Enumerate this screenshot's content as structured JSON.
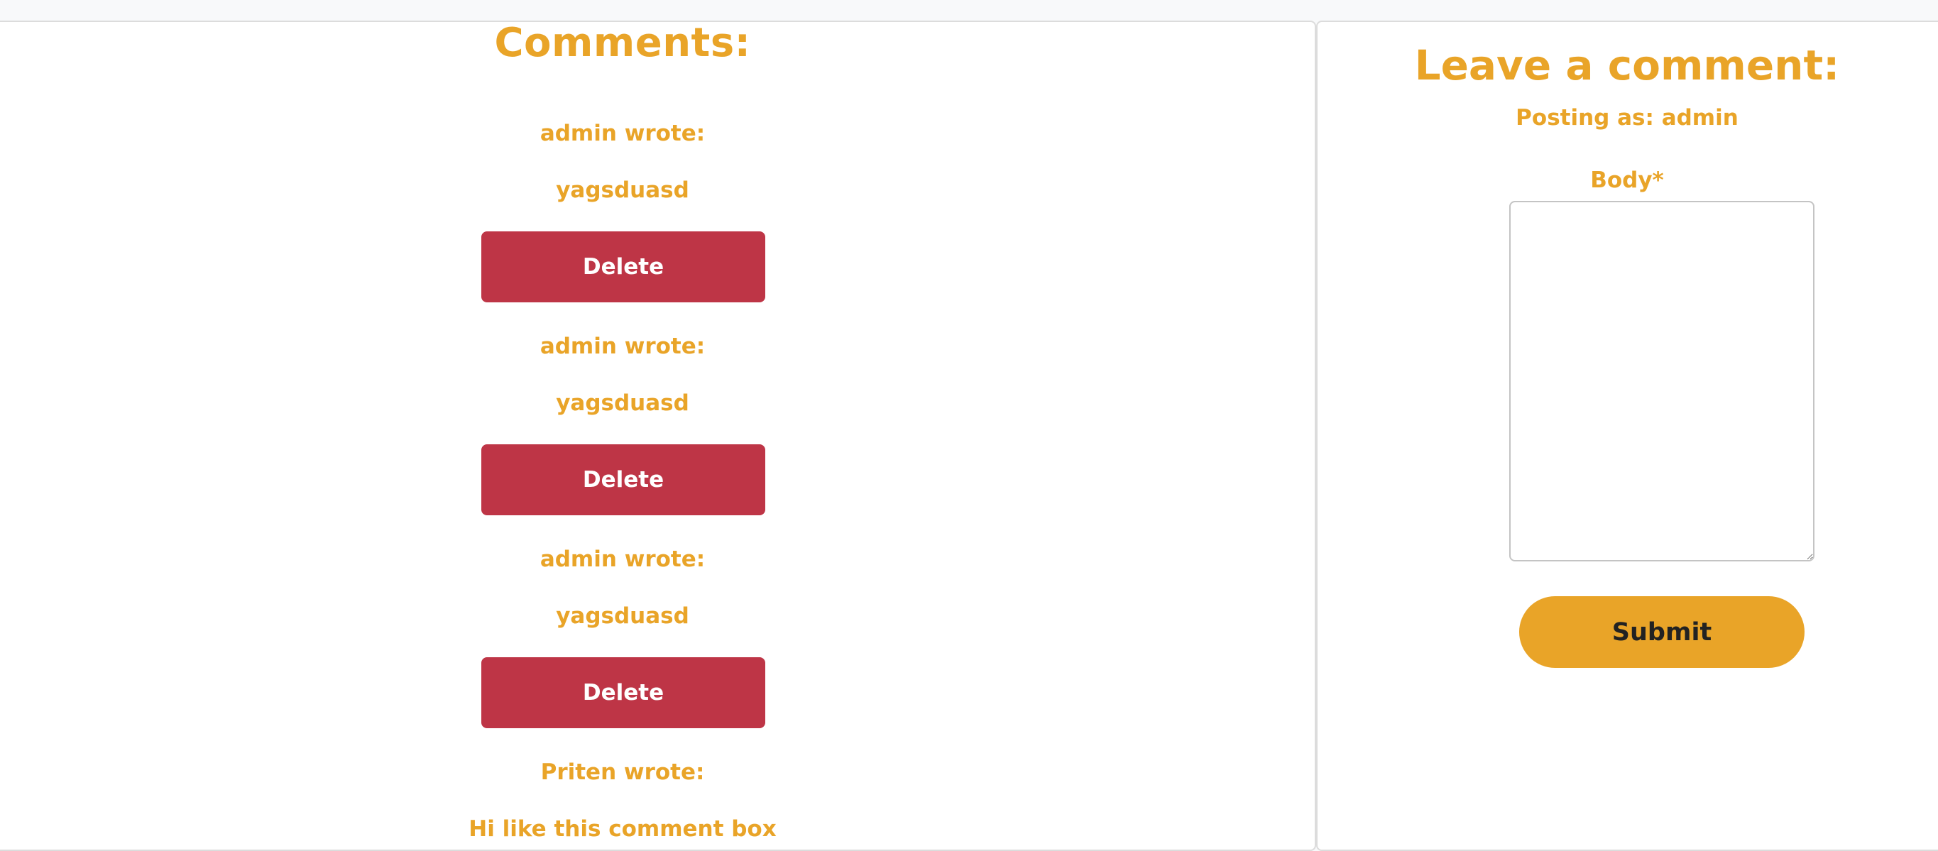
{
  "comments_section": {
    "title": "Comments:",
    "items": [
      {
        "author_line": "admin wrote:",
        "body": "yagsduasd",
        "delete_label": "Delete"
      },
      {
        "author_line": "admin wrote:",
        "body": "yagsduasd",
        "delete_label": "Delete"
      },
      {
        "author_line": "admin wrote:",
        "body": "yagsduasd",
        "delete_label": "Delete"
      },
      {
        "author_line": "Priten wrote:",
        "body": "Hi like this comment box"
      }
    ]
  },
  "comment_form": {
    "title": "Leave a comment:",
    "posting_as": "Posting as: admin",
    "body_label": "Body*",
    "body_value": "",
    "submit_label": "Submit"
  },
  "colors": {
    "accent": "#e9a428",
    "danger": "#be3546",
    "text_dark": "#222222"
  }
}
